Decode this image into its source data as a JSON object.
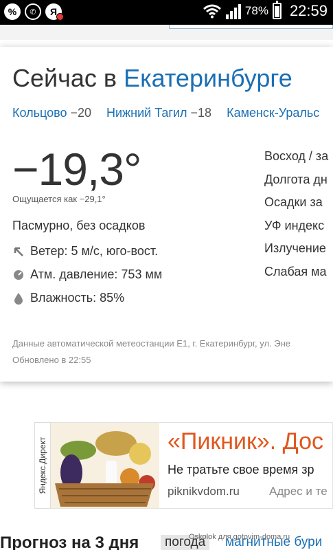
{
  "status_bar": {
    "battery": "78%",
    "time": "22:59",
    "icons": [
      "percent-icon",
      "whatsapp-icon",
      "yandex-notification-icon",
      "wifi-icon",
      "signal-icon",
      "battery-icon"
    ]
  },
  "current": {
    "headline_prefix": "Сейчас в",
    "city": "Екатеринбурге",
    "nearby": [
      {
        "name": "Кольцово",
        "temp": "−20"
      },
      {
        "name": "Нижний Тагил",
        "temp": "−18"
      },
      {
        "name": "Каменск-Уральс",
        "temp": ""
      }
    ],
    "temperature": "−19,3°",
    "feels_like": "Ощущается как −29,1°",
    "condition": "Пасмурно, без осадков",
    "wind": "Ветер: 5 м/с, юго-вост.",
    "pressure": "Атм. давление: 753 мм",
    "humidity": "Влажность: 85%",
    "right_column": [
      "Восход / за",
      "Долгота дн",
      "Осадки за",
      "УФ индекс",
      "Излучение",
      "Слабая ма"
    ],
    "source": "Данные автоматической метеостанции Е1, г. Екатеринбург, ул. Эне",
    "updated": "Обновлено в 22:55"
  },
  "ad": {
    "label": "Яндекс.Директ",
    "title": "«Пикник». Дос",
    "text": "Не тратьте свое время зр",
    "domain": "piknikvdom.ru",
    "address": "Адрес и те"
  },
  "bottom": {
    "forecast_title": "Прогноз на 3 дня",
    "tab_weather": "погода",
    "tab_magnetic": "магнитные бури"
  },
  "watermark": "Oskolok для gotovim-doma.ru",
  "colors": {
    "link": "#1a6fb4",
    "ad_title": "#e0571d"
  }
}
